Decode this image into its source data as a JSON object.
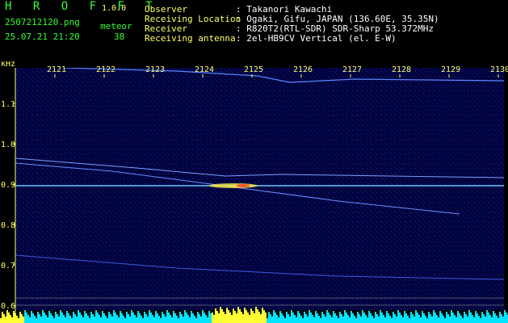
{
  "header": {
    "app_name": "H R O F F T",
    "version": "1.0.0",
    "filename": "2507212120.png",
    "datetime": "25.07.21 21:20",
    "meteor_label": "meteor",
    "meteor_count": "38"
  },
  "info": {
    "observer_label": "Observer",
    "observer_value": ": Takanori Kawachi",
    "location_label": "Receiving Location",
    "location_value": ": Ogaki, Gifu, JAPAN (136.60E, 35.35N)",
    "receiver_label": "Receiver",
    "receiver_value": ": R820T2(RTL-SDR) SDR-Sharp 53.372MHz",
    "antenna_label": "Receiving antenna",
    "antenna_value": ": 2el-HB9CV Vertical (el. E-W)"
  },
  "axis": {
    "unit": "kHz",
    "time_ticks": [
      "2121",
      "2122",
      "2123",
      "2124",
      "2125",
      "2126",
      "2127",
      "2128",
      "2129",
      "2130"
    ],
    "freq_ticks": [
      "1.1",
      "1.0",
      "0.9",
      "0.8",
      "0.7",
      "0.6"
    ]
  },
  "colors": {
    "background": "#00003a",
    "trace": "#66ccff",
    "noise_bar": "#00e5ff",
    "noise_peak": "#ffff33",
    "label": "#ffff66",
    "text": "#ffffff",
    "accent": "#33ff33"
  }
}
